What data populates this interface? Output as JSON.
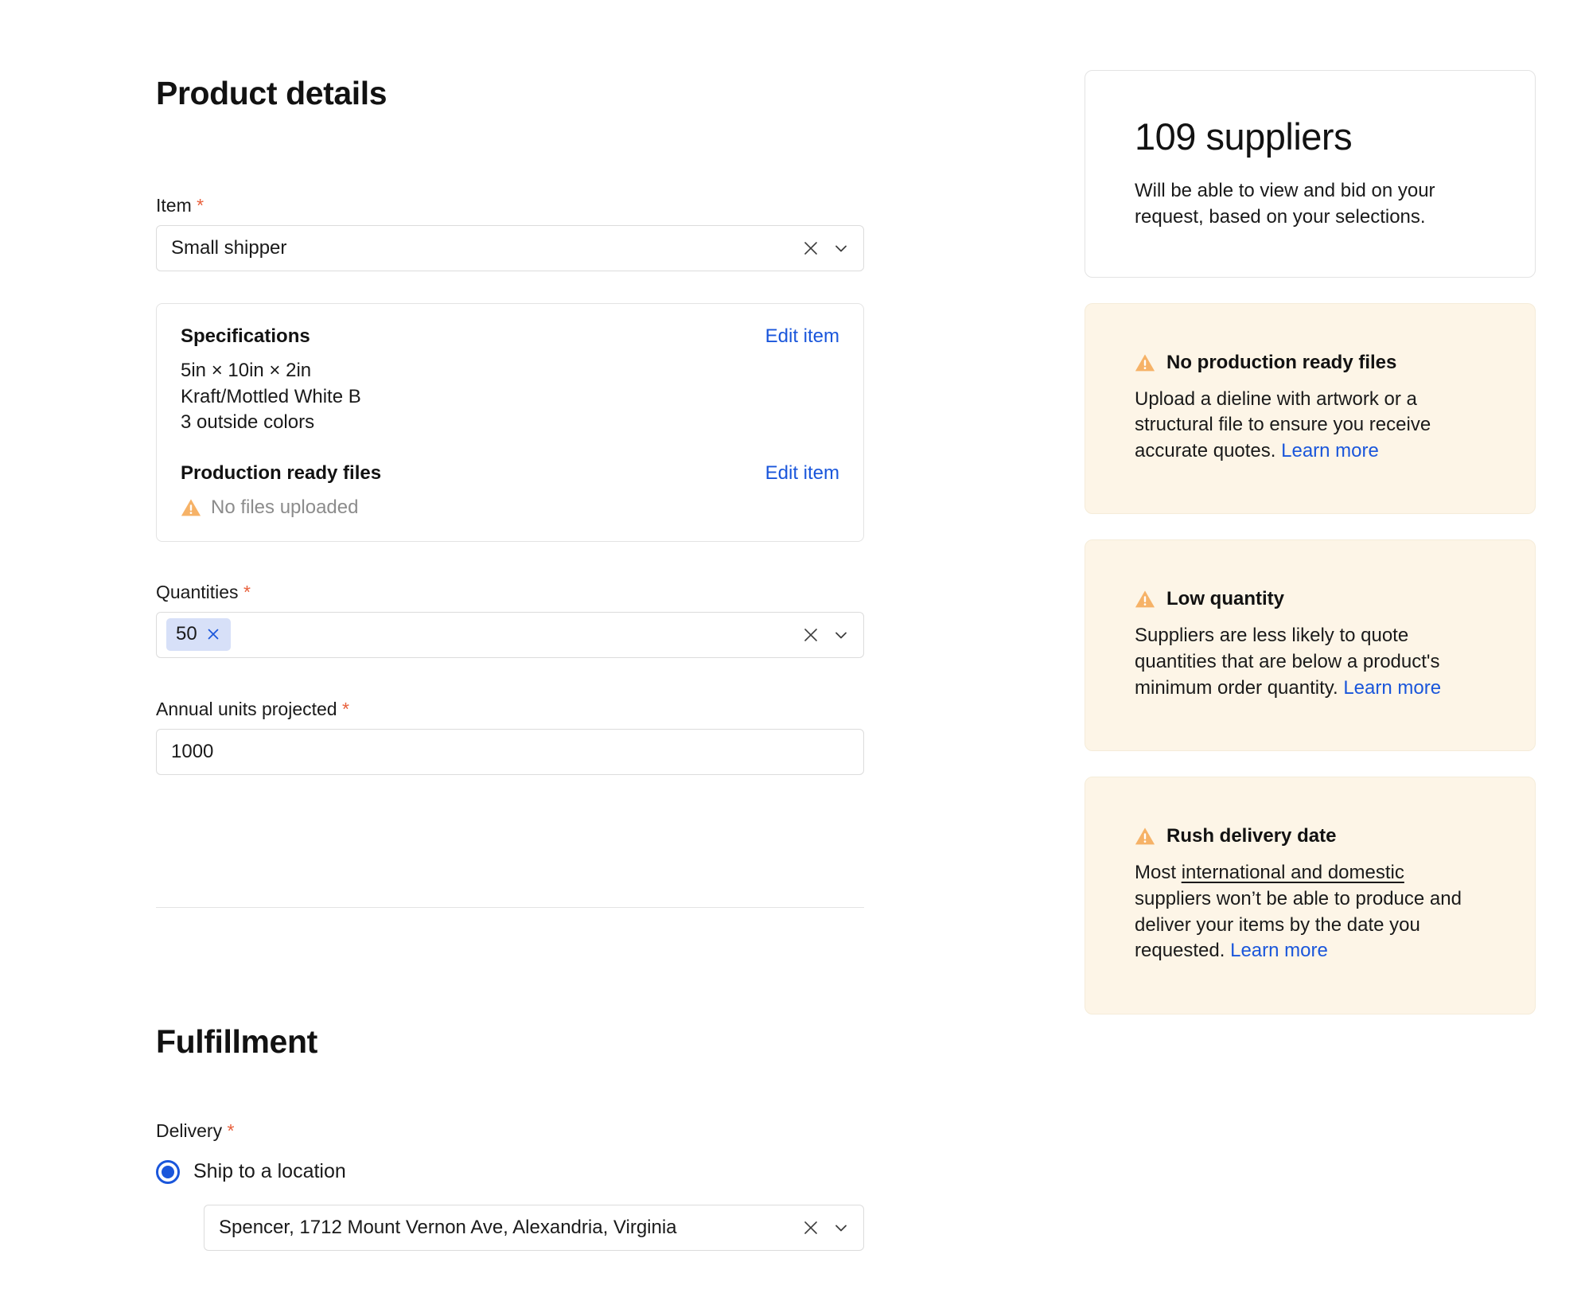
{
  "product_details": {
    "heading": "Product details",
    "item": {
      "label": "Item",
      "required_marker": "*",
      "value": "Small shipper",
      "clear_icon": "close-x-icon",
      "dropdown_icon": "chevron-down-icon"
    },
    "spec_card": {
      "specifications_heading": "Specifications",
      "specifications_edit_link": "Edit item",
      "spec_lines": [
        "5in × 10in × 2in",
        "Kraft/Mottled White B",
        "3 outside colors"
      ],
      "production_files_heading": "Production ready files",
      "production_files_edit_link": "Edit item",
      "no_files_text": "No files uploaded",
      "no_files_icon": "warning-triangle-icon"
    },
    "quantities": {
      "label": "Quantities",
      "required_marker": "*",
      "chips": [
        {
          "value": "50",
          "remove_icon": "close-x-icon"
        }
      ],
      "clear_icon": "close-x-icon",
      "dropdown_icon": "chevron-down-icon"
    },
    "annual_units": {
      "label": "Annual units projected",
      "required_marker": "*",
      "value": "1000"
    }
  },
  "fulfillment": {
    "heading": "Fulfillment",
    "delivery": {
      "label": "Delivery",
      "required_marker": "*",
      "options": [
        {
          "label": "Ship to a location",
          "selected": true
        }
      ],
      "location": {
        "value": "Spencer, 1712 Mount Vernon Ave, Alexandria, Virginia",
        "clear_icon": "close-x-icon",
        "dropdown_icon": "chevron-down-icon"
      }
    }
  },
  "sidebar": {
    "supplier_card": {
      "count_text": "109 suppliers",
      "description": "Will be able to view and bid on your request, based on your selections."
    },
    "warnings": [
      {
        "icon": "warning-triangle-icon",
        "title": "No production ready files",
        "body_before": "Upload a dieline with artwork or a structural file to ensure you receive accurate quotes. ",
        "link_text": "Learn more",
        "body_after": ""
      },
      {
        "icon": "warning-triangle-icon",
        "title": "Low quantity",
        "body_before": "Suppliers are less likely to quote quantities that are below a product's minimum order quantity. ",
        "link_text": "Learn more",
        "body_after": ""
      },
      {
        "icon": "warning-triangle-icon",
        "title": "Rush delivery date",
        "body_lead": "Most ",
        "body_underlined": "international and domestic",
        "body_before": " suppliers won’t be able to produce and deliver your items by the date you requested. ",
        "link_text": "Learn more",
        "body_after": ""
      }
    ]
  },
  "colors": {
    "link_blue": "#1a56db",
    "required_orange": "#e8603c",
    "warning_amber": "#f6b267",
    "warning_card_bg": "#fdf5e7",
    "chip_bg": "#d7e0f8"
  }
}
